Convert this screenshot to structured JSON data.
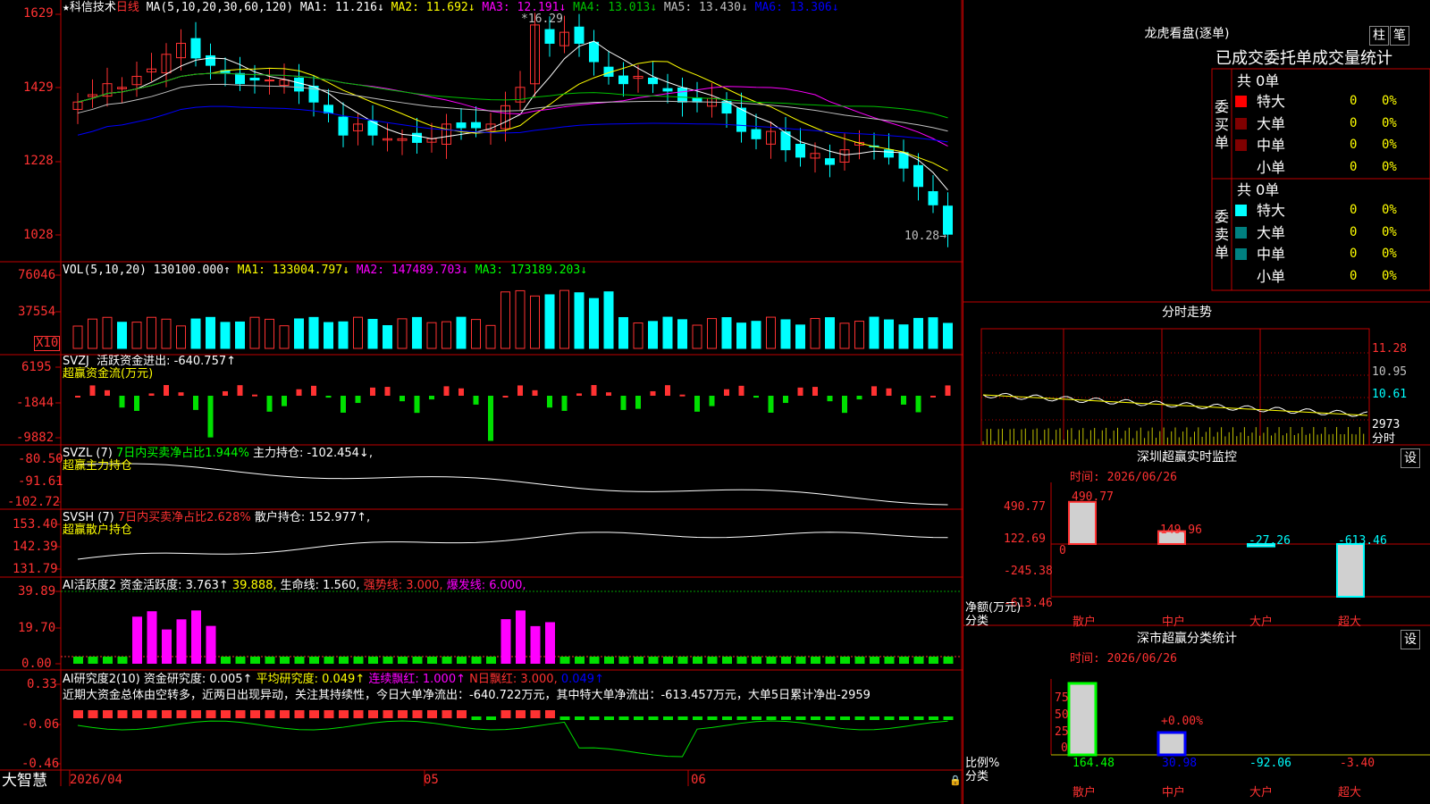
{
  "colors": {
    "up": "#ff3232",
    "down": "#00ffff",
    "green": "#00e000",
    "ma1": "#ffffff",
    "ma2": "#ffff00",
    "ma3": "#ff00ff",
    "ma4": "#00c000",
    "ma5": "#c0c0c0",
    "ma6": "#0000ff",
    "grid": "#c00000"
  },
  "chart": {
    "stock_name": "科信技术",
    "period": "日线",
    "ma_params": "MA(5,10,20,30,60,120)",
    "ma1": "MA1: 11.216↓",
    "ma2": "MA2: 11.692↓",
    "ma3": "MA3: 12.191↓",
    "ma4": "MA4: 13.013↓",
    "ma5": "MA5: 13.430↓",
    "ma6": "MA6: 13.306↓",
    "high_label": "16.29",
    "low_label": "10.28",
    "price_axis": [
      "1629",
      "1429",
      "1228",
      "1028"
    ],
    "vol_header": "VOL(5,10,20)",
    "vol_value": "130100.000↑",
    "vol_ma1": "MA1: 133004.797↓",
    "vol_ma2": "MA2: 147489.703↓",
    "vol_ma3": "MA3: 173189.203↓",
    "vol_axis": [
      "76046",
      "37554"
    ],
    "vol_unit": "X10",
    "svzj_header": "SVZJ",
    "svzj_text": "活跃资金进出: -640.757↑",
    "svzj_sub": "超赢资金流(万元)",
    "svzj_axis": [
      "6195",
      "-1844",
      "-9882"
    ],
    "svzl_header": "SVZL (7)",
    "svzl_ratio": "7日内买卖净占比1.944%",
    "svzl_hold": "主力持仓: -102.454↓,",
    "svzl_sub": "超赢主力持仓",
    "svzl_axis": [
      "-80.50",
      "-91.61",
      "-102.72"
    ],
    "svsh_header": "SVSH (7)",
    "svsh_ratio": "7日内买卖净占比2.628%",
    "svsh_hold": "散户持仓: 152.977↑,",
    "svsh_sub": "超赢散户持仓",
    "svsh_axis": [
      "153.40",
      "142.39",
      "131.79"
    ],
    "ai_header": "AI活跃度2",
    "ai_active": "资金活跃度: 3.763↑",
    "ai_v2": "39.888,",
    "ai_life": "生命线: 1.560,",
    "ai_strong": "强势线: 3.000,",
    "ai_burst": "爆发线: 6.000,",
    "ai_axis": [
      "39.89",
      "19.70",
      "0.00"
    ],
    "research_header": "AI研究度2(10)",
    "research_val": "资金研究度: 0.005↑",
    "research_avg": "平均研究度: 0.049↑",
    "research_red": "连续飘红: 1.000↑",
    "research_n": "N日飘红: 3.000,",
    "research_last": "0.049↑",
    "research_axis": [
      "0.33",
      "-0.06",
      "-0.46"
    ],
    "commentary": "近期大资金总体由空转多，近两日出现异动，关注其持续性，今日大单净流出：-640.722万元，其中特大单净流出：-613.457万元，大单5日累计净出-2959",
    "date_labels": [
      "2026/04",
      "05",
      "06"
    ],
    "brand": "大智慧"
  },
  "right": {
    "dragon_title": "龙虎看盘(逐单)",
    "btn_zhu": "柱",
    "btn_bi": "笔",
    "table_header": "已成交委托单成交量统计",
    "buy_label": "委买单",
    "sell_label": "委卖单",
    "buy_total": "共 0单",
    "sell_total": "共 0单",
    "buy_rows": [
      {
        "name": "特大",
        "v": "0",
        "p": "0%"
      },
      {
        "name": "大单",
        "v": "0",
        "p": "0%"
      },
      {
        "name": "中单",
        "v": "0",
        "p": "0%"
      },
      {
        "name": "小单",
        "v": "0",
        "p": "0%"
      }
    ],
    "sell_rows": [
      {
        "name": "特大",
        "v": "0",
        "p": "0%"
      },
      {
        "name": "大单",
        "v": "0",
        "p": "0%"
      },
      {
        "name": "中单",
        "v": "0",
        "p": "0%"
      },
      {
        "name": "小单",
        "v": "0",
        "p": "0%"
      }
    ],
    "intraday_title": "分时走势",
    "intraday_axis": [
      "11.28",
      "10.95",
      "10.61"
    ],
    "intraday_vol": "2973",
    "intraday_unit": "分时",
    "monitor_title": "深圳超赢实时监控",
    "monitor_btn": "设",
    "monitor_time": "时间: 2026/06/26",
    "monitor_axis": [
      "490.77",
      "122.69",
      "0",
      "-245.38",
      "-613.46"
    ],
    "monitor_ylabel": "净额(万元)",
    "monitor_xlabel": "分类",
    "monitor_values": [
      "490.77",
      "149.96",
      "-27.26",
      "-613.46"
    ],
    "categories": [
      "散户",
      "中户",
      "大户",
      "超大"
    ],
    "class_title": "深市超赢分类统计",
    "class_btn": "设",
    "class_time": "时间: 2026/06/26",
    "class_axis": [
      "75",
      "50",
      "25",
      "0"
    ],
    "class_pct": "+0.00%",
    "class_ylabel": "比例%",
    "class_xlabel": "分类",
    "class_values": [
      "164.48",
      "30.98",
      "-92.06",
      "-3.40"
    ]
  },
  "chart_data": {
    "type": "candlestick",
    "note_close_high": 16.29,
    "note_close_low": 10.28,
    "monitor": {
      "categories": [
        "散户",
        "中户",
        "大户",
        "超大"
      ],
      "values": [
        490.77,
        149.96,
        -27.26,
        -613.46
      ]
    },
    "class": {
      "categories": [
        "散户",
        "中户",
        "大户",
        "超大"
      ],
      "values": [
        164.48,
        30.98,
        -92.06,
        -3.4
      ]
    }
  }
}
